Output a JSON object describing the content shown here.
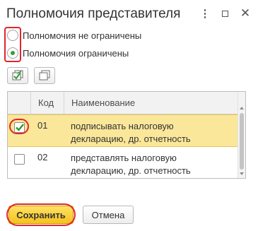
{
  "window": {
    "title": "Полномочия представителя",
    "more_icon": "more-vertical-icon",
    "maximize_icon": "maximize-icon",
    "close_icon": "close-icon"
  },
  "authority": {
    "options": [
      {
        "label": "Полномочия не ограничены",
        "selected": false
      },
      {
        "label": "Полномочия ограничены",
        "selected": true
      }
    ]
  },
  "toolbar": {
    "check_all_icon": "check-all-icon",
    "uncheck_all_icon": "uncheck-all-icon"
  },
  "table": {
    "columns": {
      "check": "",
      "code": "Код",
      "name": "Наименование"
    },
    "rows": [
      {
        "checked": true,
        "code": "01",
        "name_line1": "подписывать налоговую",
        "name_line2": "декларацию, др. отчетность",
        "selected": true
      },
      {
        "checked": false,
        "code": "02",
        "name_line1": "представлять налоговую",
        "name_line2": "декларацию, др. отчетность",
        "selected": false
      }
    ]
  },
  "buttons": {
    "save": "Сохранить",
    "cancel": "Отмена"
  },
  "colors": {
    "accent_green": "#3a9b3a",
    "highlight_red": "#e0262d",
    "selection_yellow": "#fbe79a",
    "primary_button": "#f6c21c"
  }
}
